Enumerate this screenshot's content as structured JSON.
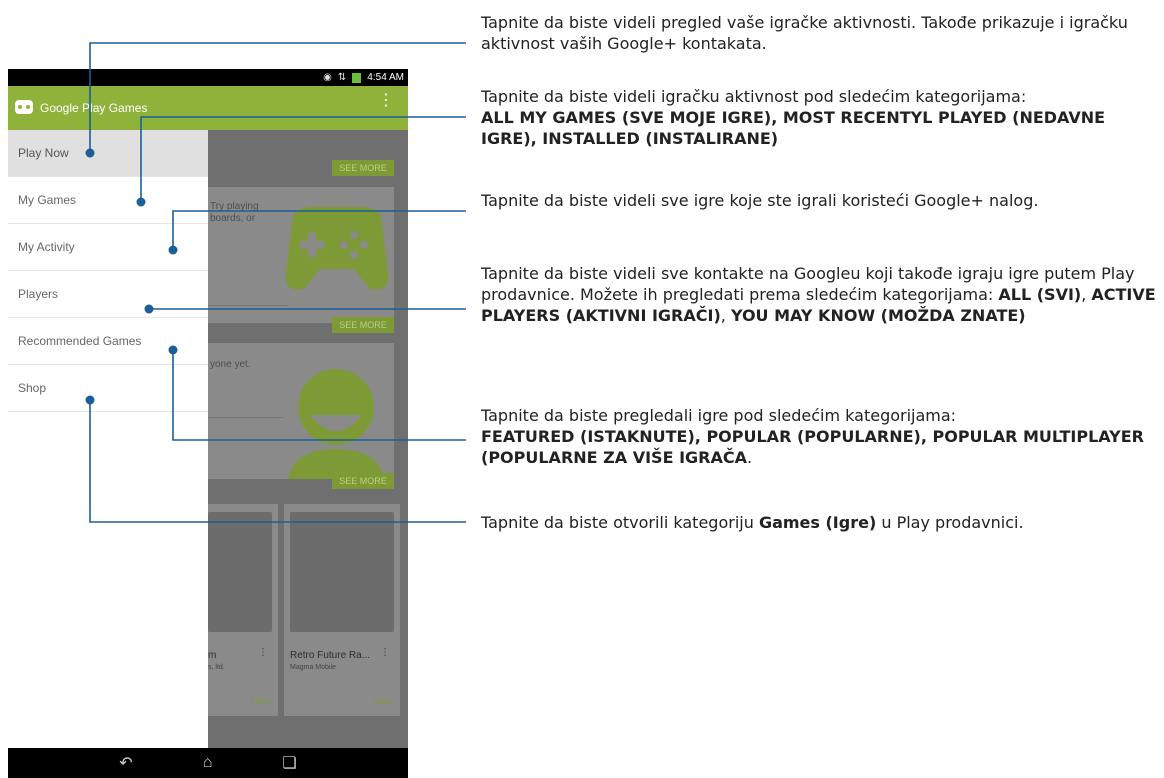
{
  "status_bar": {
    "time": "4:54 AM",
    "icons": [
      "wifi-icon",
      "signal-icon",
      "battery-icon"
    ]
  },
  "app_bar": {
    "title": "Google Play Games",
    "overflow_icon": "more-vert-icon"
  },
  "drawer": {
    "items": [
      {
        "label": "Play Now",
        "selected": true
      },
      {
        "label": "My Games",
        "selected": false
      },
      {
        "label": "My Activity",
        "selected": false
      },
      {
        "label": "Players",
        "selected": false
      },
      {
        "label": "Recommended Games",
        "selected": false
      },
      {
        "label": "Shop",
        "selected": false
      }
    ]
  },
  "background": {
    "see_more_label": "SEE MORE",
    "card1_text_line1": "Try playing",
    "card1_text_line2": "boards, or",
    "card2_text": "yone yet.",
    "games": [
      {
        "name": "m",
        "developer": "s, ltd.",
        "price": "FREE"
      },
      {
        "name": "Retro Future Ra...",
        "developer": "Magma Mobile",
        "price": "FREE"
      }
    ]
  },
  "nav_bar": {
    "icons": [
      "back-icon",
      "home-icon",
      "recents-icon"
    ]
  },
  "callouts": [
    {
      "text": "Tapnite da biste videli pregled vaše igračke aktivnosti. Takođe prikazuje i igračku aktivnost vaših Google+ kontakata."
    },
    {
      "text": "Tapnite da biste videli igračku aktivnost pod sledećim kategorijama:",
      "bold": "ALL MY GAMES (SVE MOJE IGRE), MOST RECENTYL PLAYED (NEDAVNE IGRE), INSTALLED (INSTALIRANE)"
    },
    {
      "text": "Tapnite da biste videli sve igre koje ste igrali koristeći Google+ nalog."
    },
    {
      "text": "Tapnite da biste videli sve kontakte na Googleu koji takođe igraju igre putem Play prodavnice. Možete ih pregledati prema sledećim kategorijama:",
      "bold1": "ALL (SVI)",
      "sep1": ", ",
      "bold2": "ACTIVE PLAYERS (AKTIVNI IGRAČI)",
      "sep2": ", ",
      "bold3": "YOU MAY KNOW (MOŽDA ZNATE)"
    },
    {
      "text": "Tapnite da biste pregledali igre pod sledećim kategorijama:",
      "bold": "FEATURED (ISTAKNUTE), POPULAR (POPULARNE), POPULAR MULTIPLAYER (POPULARNE ZA VIŠE IGRAČA",
      "tail": "."
    },
    {
      "text_before": "Tapnite da biste otvorili kategoriju ",
      "bold": "Games (Igre)",
      "text_after": " u Play prodavnici."
    }
  ]
}
